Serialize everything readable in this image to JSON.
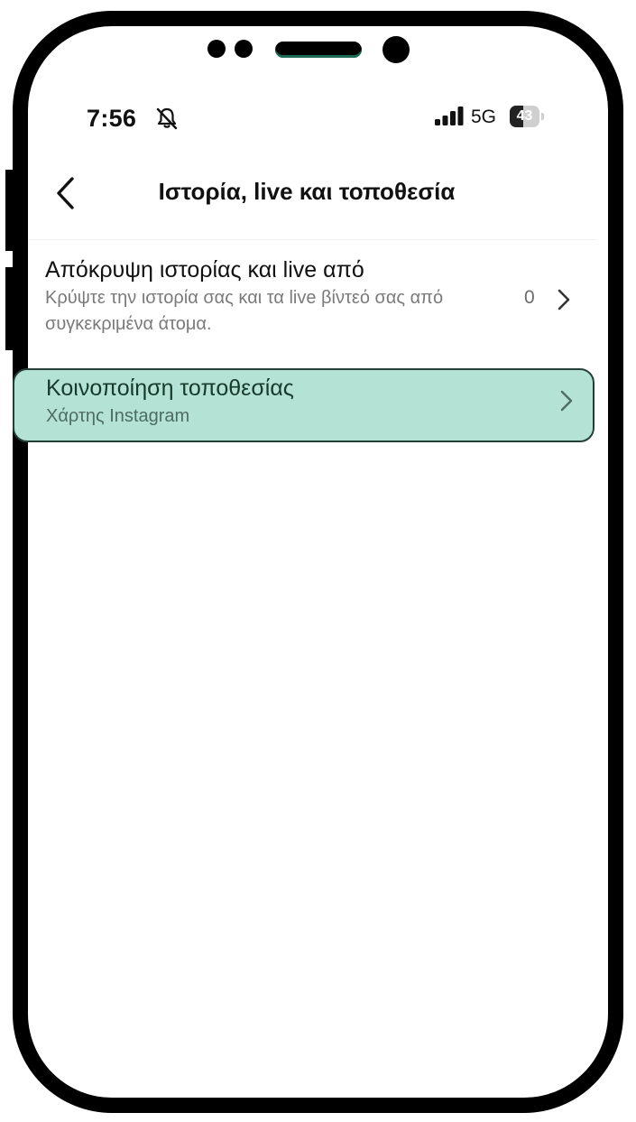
{
  "status_bar": {
    "time": "7:56",
    "network": "5G",
    "battery": "43",
    "icons": [
      "bell-muted-icon",
      "signal-icon",
      "battery-icon"
    ]
  },
  "header": {
    "title": "Ιστορία, live και τοποθεσία",
    "back_icon": "chevron-left-icon"
  },
  "settings": [
    {
      "title": "Απόκρυψη ιστορίας και live από",
      "subtitle": "Κρύψτε την ιστορία σας και τα live βίντεό σας από συγκεκριμένα άτομα.",
      "count": "0",
      "icon": "chevron-right-icon"
    },
    {
      "title": "Κοινοποίηση τοποθεσίας",
      "subtitle": "Χάρτης Instagram",
      "icon": "chevron-right-icon",
      "highlighted": true
    }
  ],
  "colors": {
    "highlight": "#b4e3d5",
    "highlight_border": "#244036",
    "frame": "#000000"
  }
}
